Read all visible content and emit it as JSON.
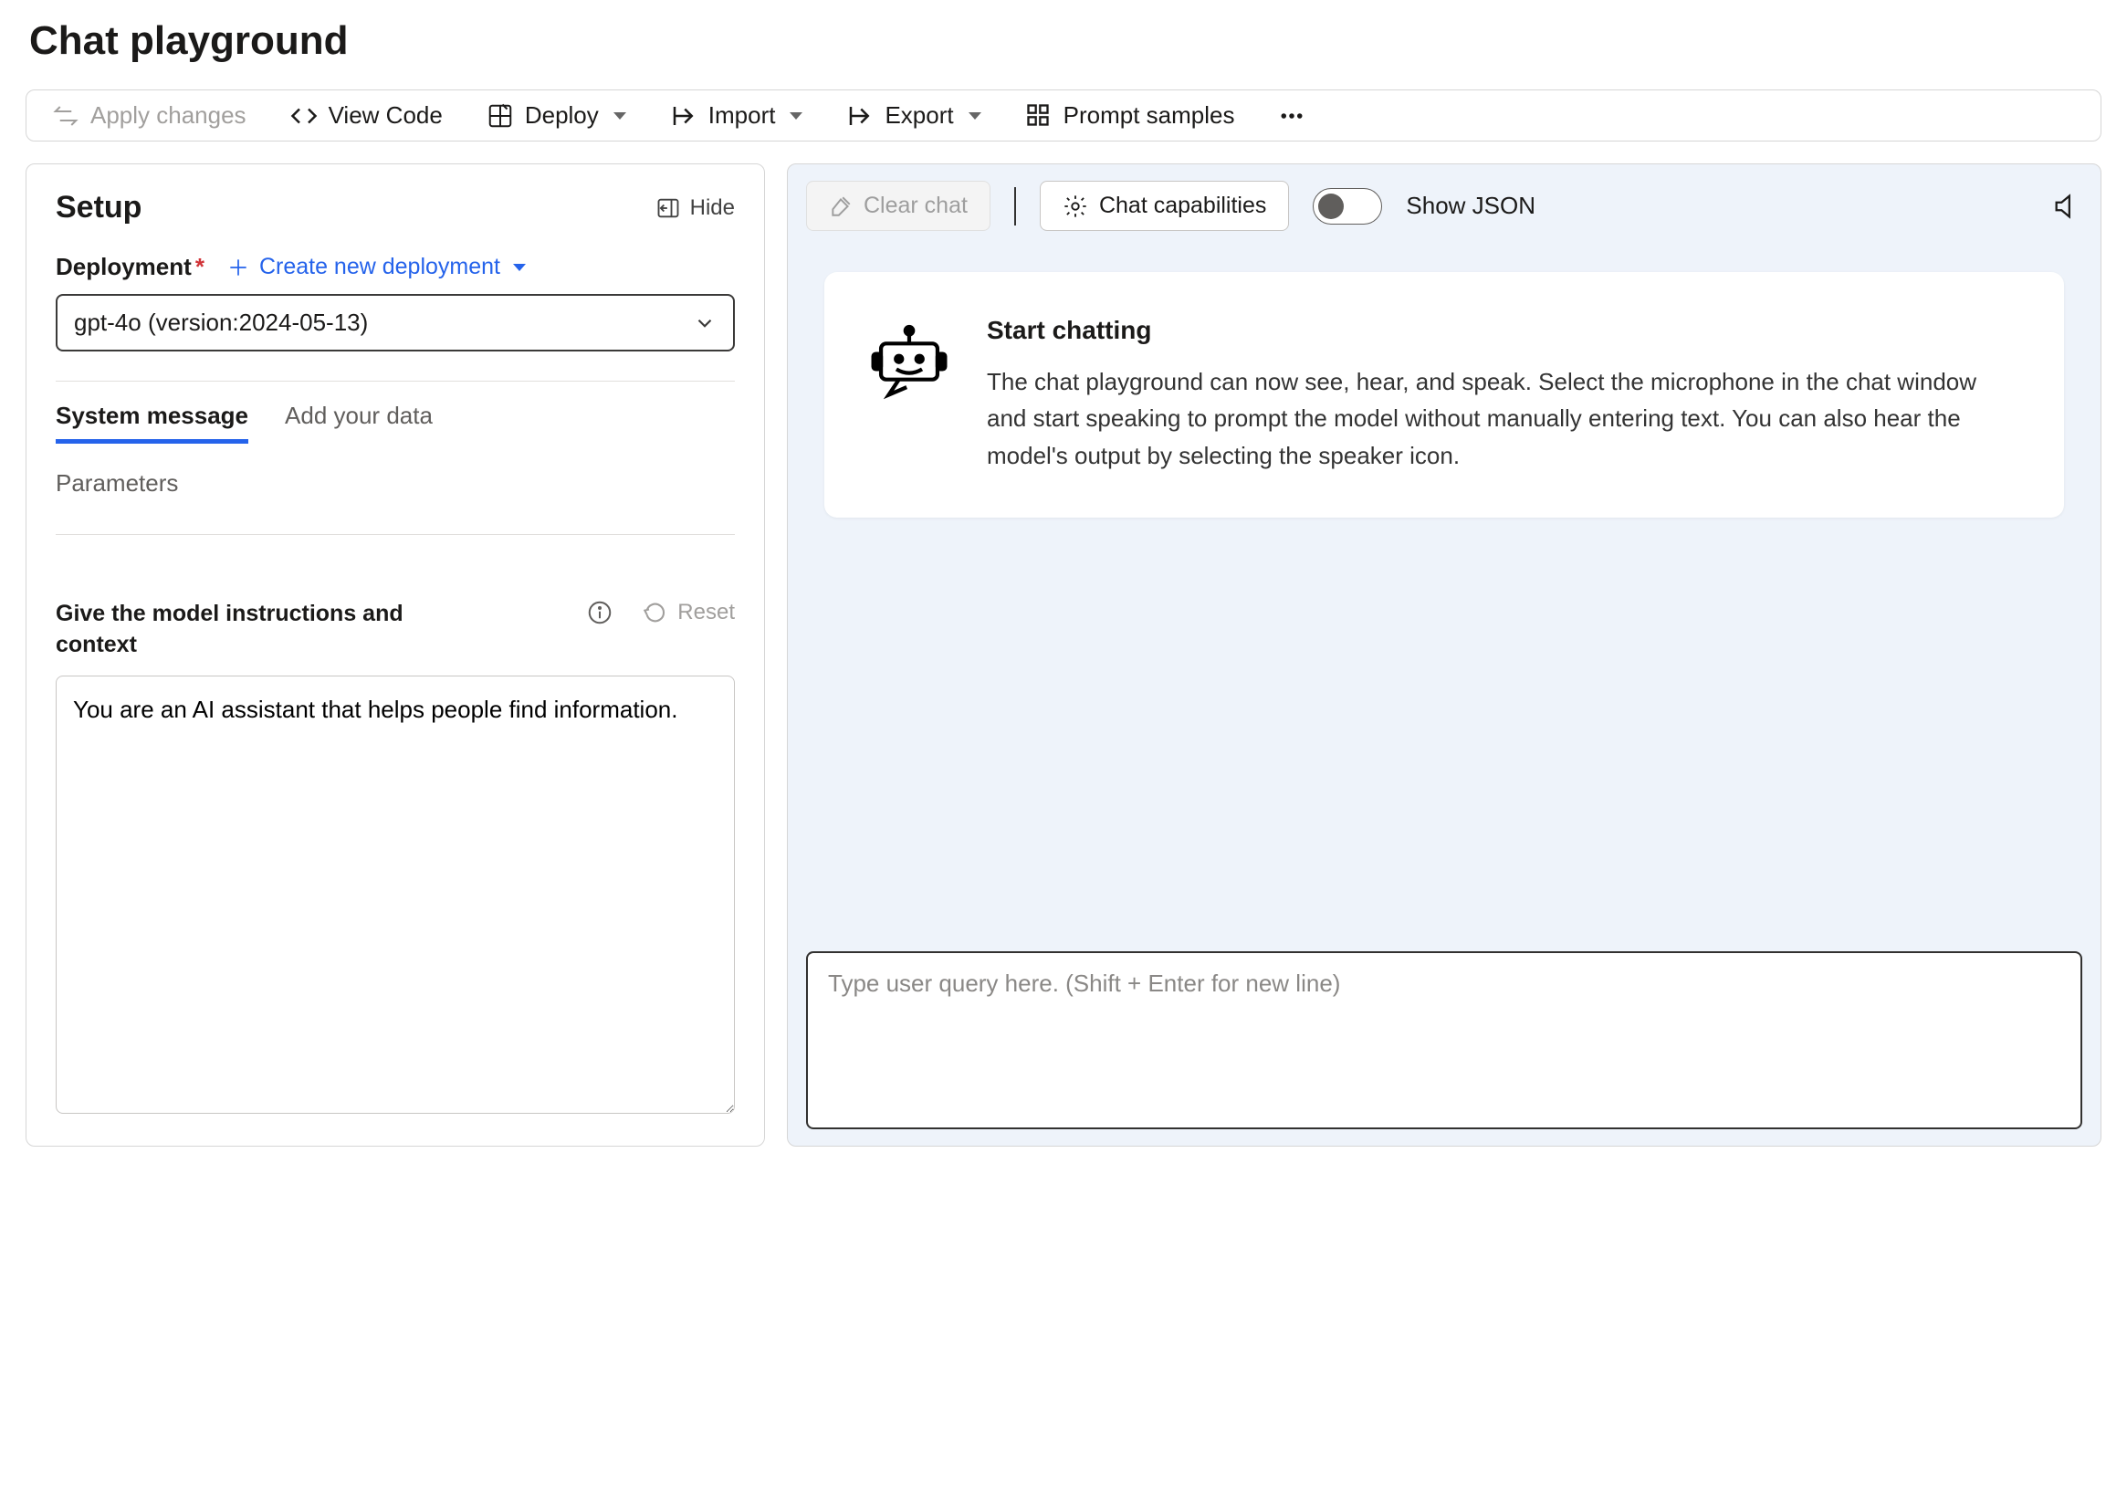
{
  "title": "Chat playground",
  "toolbar": {
    "apply_changes": "Apply changes",
    "view_code": "View Code",
    "deploy": "Deploy",
    "import": "Import",
    "export": "Export",
    "prompt_samples": "Prompt samples"
  },
  "setup": {
    "heading": "Setup",
    "hide": "Hide",
    "deployment_label": "Deployment",
    "create_new": "Create new deployment",
    "deployment_value": "gpt-4o (version:2024-05-13)",
    "tabs": {
      "system_message": "System message",
      "add_your_data": "Add your data",
      "parameters": "Parameters"
    },
    "instructions_label": "Give the model instructions and context",
    "reset": "Reset",
    "system_message_text": "You are an AI assistant that helps people find information."
  },
  "chat": {
    "clear": "Clear chat",
    "capabilities": "Chat capabilities",
    "show_json": "Show JSON",
    "card_title": "Start chatting",
    "card_body": "The chat playground can now see, hear, and speak. Select the microphone in the chat window and start speaking to prompt the model without manually entering text. You can also hear the model's output by selecting the speaker icon.",
    "input_placeholder": "Type user query here. (Shift + Enter for new line)"
  }
}
